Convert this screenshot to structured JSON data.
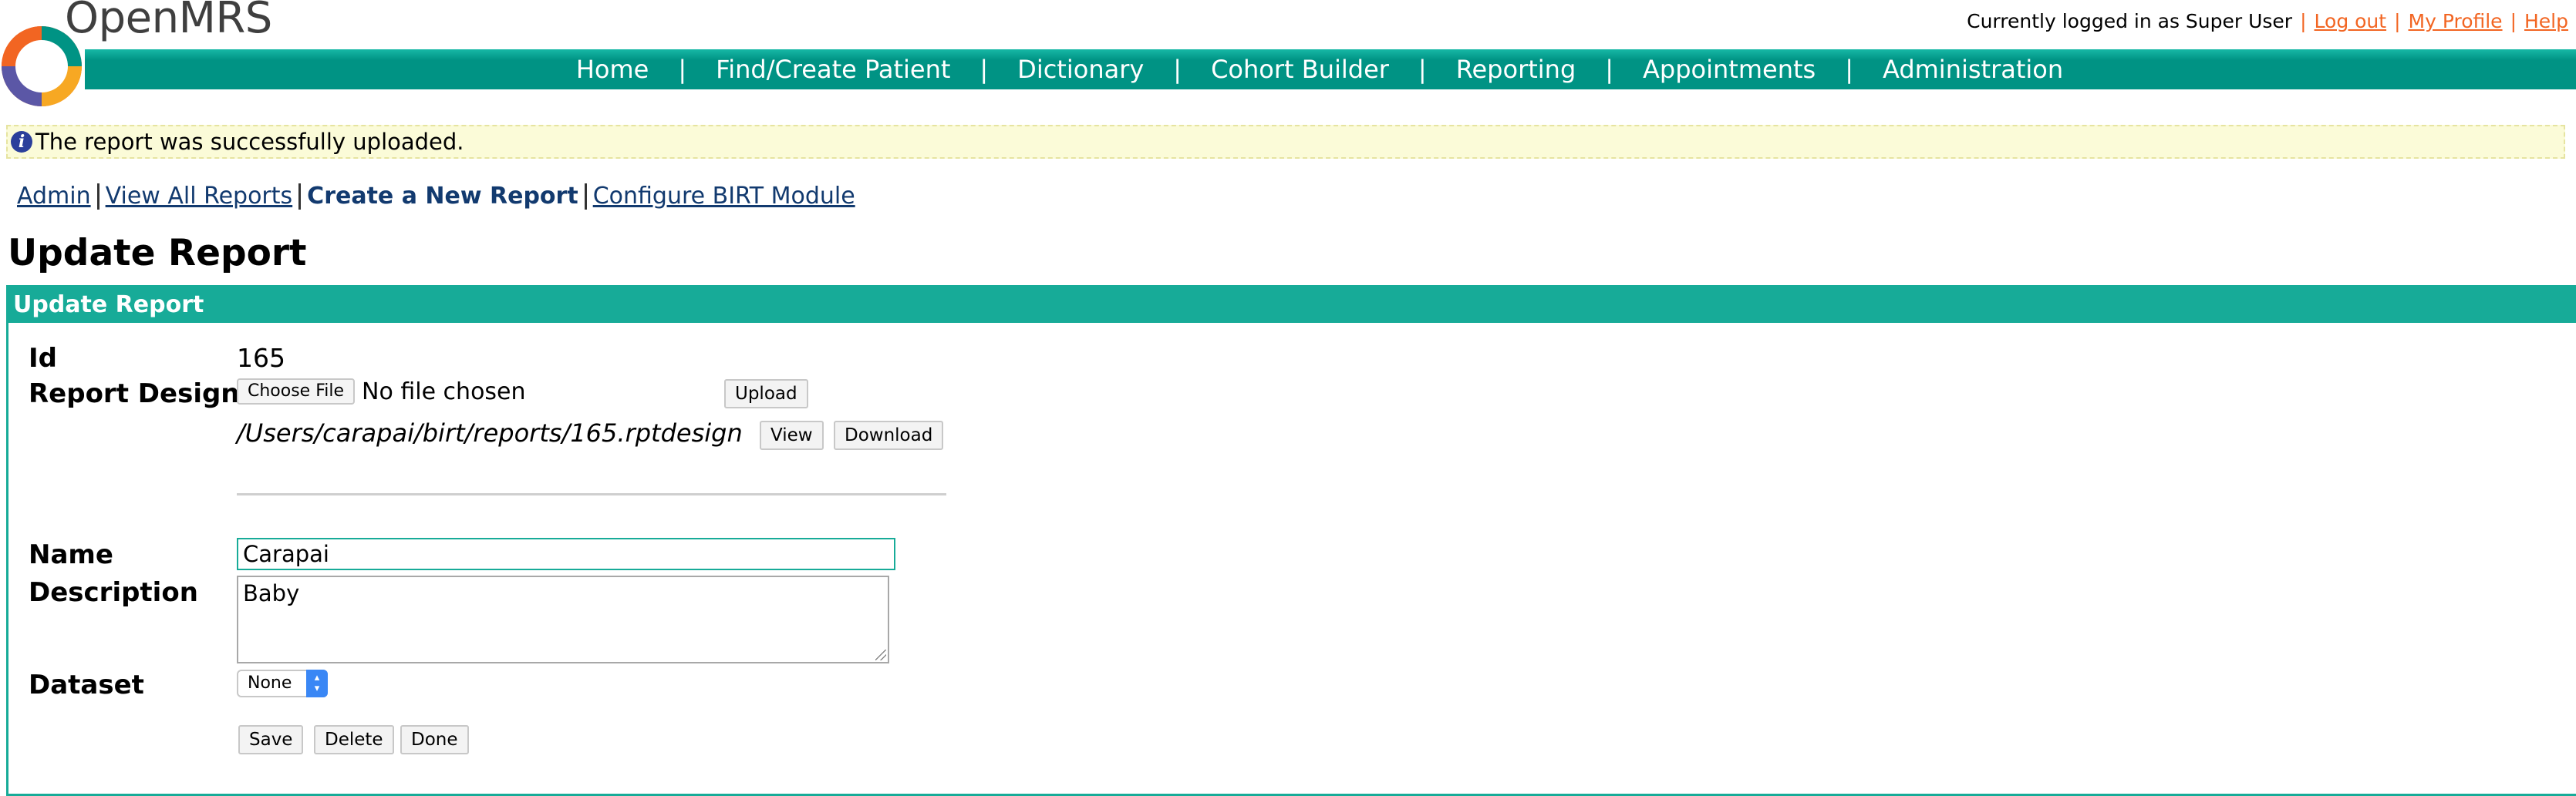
{
  "app": {
    "logo_text": "OpenMRS"
  },
  "user": {
    "logged_in_text": "Currently logged in as Super User",
    "logout": "Log out",
    "profile": "My Profile",
    "help": "Help"
  },
  "nav": {
    "items": [
      "Home",
      "Find/Create Patient",
      "Dictionary",
      "Cohort Builder",
      "Reporting",
      "Appointments",
      "Administration"
    ]
  },
  "message": {
    "text": "The report was successfully uploaded.",
    "icon": "info-icon"
  },
  "subnav": {
    "admin": "Admin",
    "view_all": "View All Reports",
    "create_new": "Create a New Report",
    "configure": "Configure BIRT Module"
  },
  "page": {
    "title": "Update Report"
  },
  "form": {
    "header": "Update Report",
    "id_label": "Id",
    "id_value": "165",
    "design_label": "Report Design",
    "choose_file": "Choose File",
    "no_file": "No file chosen",
    "upload": "Upload",
    "design_path": "/Users/carapai/birt/reports/165.rptdesign",
    "view": "View",
    "download": "Download",
    "name_label": "Name",
    "name_value": "Carapai",
    "description_label": "Description",
    "description_value": "Baby",
    "dataset_label": "Dataset",
    "dataset_value": "None",
    "save": "Save",
    "delete": "Delete",
    "done": "Done"
  },
  "colors": {
    "teal": "#17ab98",
    "nav_teal": "#009384",
    "link_orange": "#f26522",
    "link_blue": "#123a6f"
  }
}
